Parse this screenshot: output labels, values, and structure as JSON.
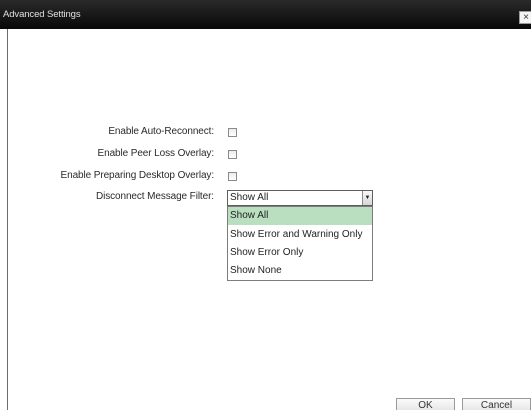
{
  "window": {
    "title": "Advanced Settings",
    "close_glyph": "×"
  },
  "form": {
    "auto_reconnect": {
      "label": "Enable Auto-Reconnect:",
      "checked": false
    },
    "peer_loss_overlay": {
      "label": "Enable Peer Loss Overlay:",
      "checked": false
    },
    "preparing_desktop_overlay": {
      "label": "Enable Preparing Desktop Overlay:",
      "checked": false
    },
    "disconnect_filter": {
      "label": "Disconnect Message Filter:",
      "selected": "Show All",
      "options": [
        "Show All",
        "Show Error and Warning Only",
        "Show Error Only",
        "Show None"
      ]
    }
  },
  "buttons": {
    "ok": "OK",
    "cancel": "Cancel"
  },
  "colors": {
    "titlebar": "#101010",
    "selected_option": "#b9dfc0"
  }
}
